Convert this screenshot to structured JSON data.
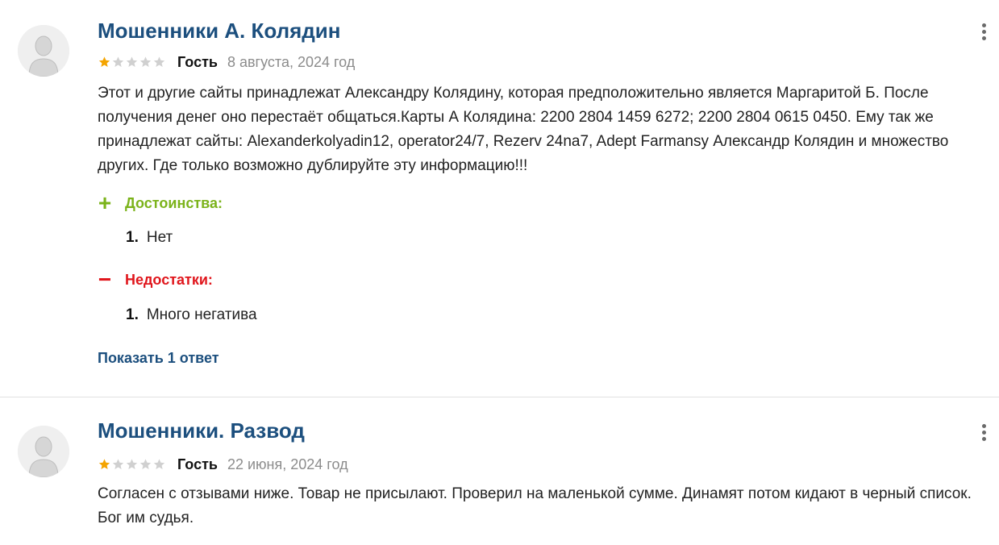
{
  "reviews": [
    {
      "title": "Мошенники А. Колядин",
      "rating": 1,
      "rating_max": 5,
      "author": "Гость",
      "date": "8 августа, 2024 год",
      "text": "Этот и другие сайты принадлежат Александру Колядину, которая предположительно является Маргаритой Б. После получения денег оно перестаёт общаться.Карты А Колядина: 2200 2804 1459 6272; 2200 2804 0615 0450. Ему так же принадлежат сайты: Alexanderkolyadin12, operator24/7, Rezerv 24na7, Adept Farmansy Александр Колядин и множество других. Где только возможно дублируйте эту информацию!!!",
      "pros_label": "Достоинства:",
      "pros": [
        {
          "num": "1.",
          "text": "Нет"
        }
      ],
      "cons_label": "Недостатки:",
      "cons": [
        {
          "num": "1.",
          "text": "Много негатива"
        }
      ],
      "show_replies": "Показать 1 ответ"
    },
    {
      "title": "Мошенники. Развод",
      "rating": 1,
      "rating_max": 5,
      "author": "Гость",
      "date": "22 июня, 2024 год",
      "text": "Согласен с отзывами ниже. Товар не присылают. Проверил на маленькой сумме. Динамят потом кидают в черный список. Бог им судья."
    }
  ],
  "icons": {
    "avatar": "user-avatar-icon",
    "more": "more-vertical-icon",
    "star_filled": "star-filled-icon",
    "star_empty": "star-empty-icon",
    "plus": "plus-icon",
    "minus": "minus-icon",
    "plus_glyph": "+",
    "minus_glyph": "−"
  },
  "colors": {
    "title": "#1c4f7e",
    "link": "#1c4f7e",
    "star_filled": "#f4a400",
    "star_empty": "#d0d0d0",
    "pros": "#7bb31a",
    "cons": "#e0161c",
    "date": "#8c8c8c"
  }
}
